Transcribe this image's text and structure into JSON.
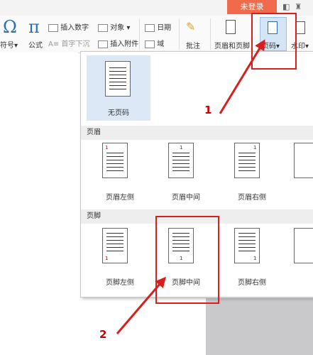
{
  "topbar": {
    "login_label": "未登录"
  },
  "ribbon": {
    "symbol_label": "符号",
    "formula_label": "公式",
    "insert_number_label": "插入数字",
    "drop_cap_label": "首字下沉",
    "object_label": "对象",
    "attachment_label": "插入附件",
    "date_label": "日期",
    "field_label": "域",
    "comment_label": "批注",
    "header_footer_label": "页眉和页脚",
    "page_number_label": "页码",
    "watermark_label": "水印"
  },
  "dropdown": {
    "none_label": "无页码",
    "header_section": "页眉",
    "footer_section": "页脚",
    "header_items": [
      "页眉左侧",
      "页眉中间",
      "页眉右侧"
    ],
    "footer_items": [
      "页脚左侧",
      "页脚中间",
      "页脚右侧"
    ],
    "page_num": "1"
  },
  "annotations": {
    "step1": "1",
    "step2": "2",
    "color": "#d81e1e"
  }
}
